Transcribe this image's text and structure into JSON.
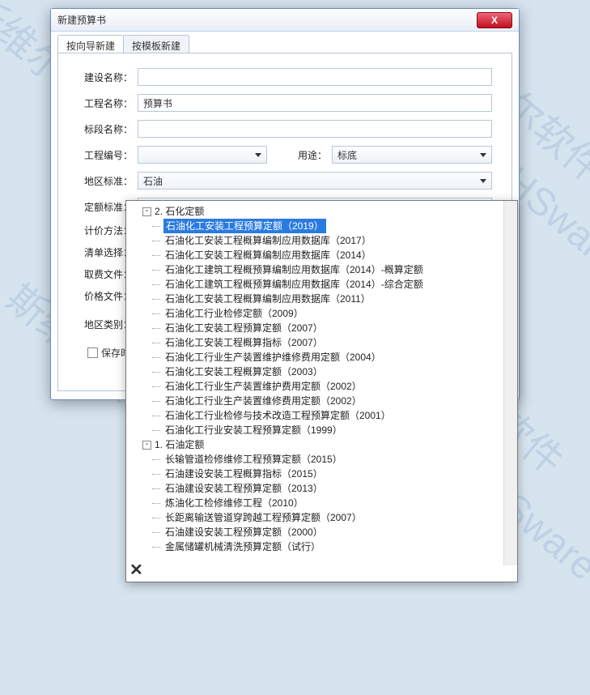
{
  "window": {
    "title": "新建预算书"
  },
  "tabs": [
    {
      "label": "按向导新建",
      "active": true
    },
    {
      "label": "按模板新建",
      "active": false
    }
  ],
  "form": {
    "construction_name": {
      "label": "建设名称：",
      "value": ""
    },
    "project_name": {
      "label": "工程名称：",
      "value": "预算书"
    },
    "section_name": {
      "label": "标段名称：",
      "value": ""
    },
    "project_no": {
      "label": "工程编号：",
      "value": ""
    },
    "usage": {
      "label": "用途：",
      "value": "标底"
    },
    "region_standard": {
      "label": "地区标准：",
      "value": "石油"
    },
    "quota_standard": {
      "label": "定额标准：",
      "value": "石油化工安装工程预算定额（2019）"
    },
    "pricing_method": {
      "label": "计价方法："
    },
    "list_select": {
      "label": "清单选择："
    },
    "fee_file": {
      "label": "取费文件："
    },
    "price_file": {
      "label": "价格文件："
    },
    "region_type": {
      "label": "地区类别："
    },
    "save_on_use": {
      "label": "保存时用"
    }
  },
  "tree": {
    "groups": [
      {
        "id": "g2",
        "header": "2. 石化定额",
        "items": [
          {
            "label": "石油化工安装工程预算定额（2019）",
            "selected": true
          },
          {
            "label": "石油化工安装工程概算编制应用数据库（2017）"
          },
          {
            "label": "石油化工安装工程概算编制应用数据库（2014）"
          },
          {
            "label": "石油化工建筑工程概预算编制应用数据库（2014）-概算定额"
          },
          {
            "label": "石油化工建筑工程概预算编制应用数据库（2014）-综合定额"
          },
          {
            "label": "石油化工安装工程概算编制应用数据库（2011）"
          },
          {
            "label": "石油化工行业检修定额（2009）"
          },
          {
            "label": "石油化工安装工程预算定额（2007）"
          },
          {
            "label": "石油化工安装工程概算指标（2007）"
          },
          {
            "label": "石油化工行业生产装置维护维修费用定额（2004）"
          },
          {
            "label": "石油化工安装工程概算定额（2003）"
          },
          {
            "label": "石油化工行业生产装置维护费用定额（2002）"
          },
          {
            "label": "石油化工行业生产装置维修费用定额（2002）"
          },
          {
            "label": "石油化工行业检修与技术改造工程预算定额（2001）"
          },
          {
            "label": "石油化工行业安装工程预算定额（1999）"
          }
        ]
      },
      {
        "id": "g1",
        "header": "1. 石油定额",
        "items": [
          {
            "label": "长输管道检修维修工程预算定额（2015）"
          },
          {
            "label": "石油建设安装工程概算指标（2015）"
          },
          {
            "label": "石油建设安装工程预算定额（2013）"
          },
          {
            "label": "炼油化工检修维修工程（2010）"
          },
          {
            "label": "长距离输送管道穿跨越工程预算定额（2007）"
          },
          {
            "label": "石油建设安装工程预算定额（2000）"
          },
          {
            "label": "金属储罐机械清洗预算定额（试行）"
          }
        ]
      }
    ]
  },
  "icons": {
    "close": "X",
    "expander": "-"
  }
}
